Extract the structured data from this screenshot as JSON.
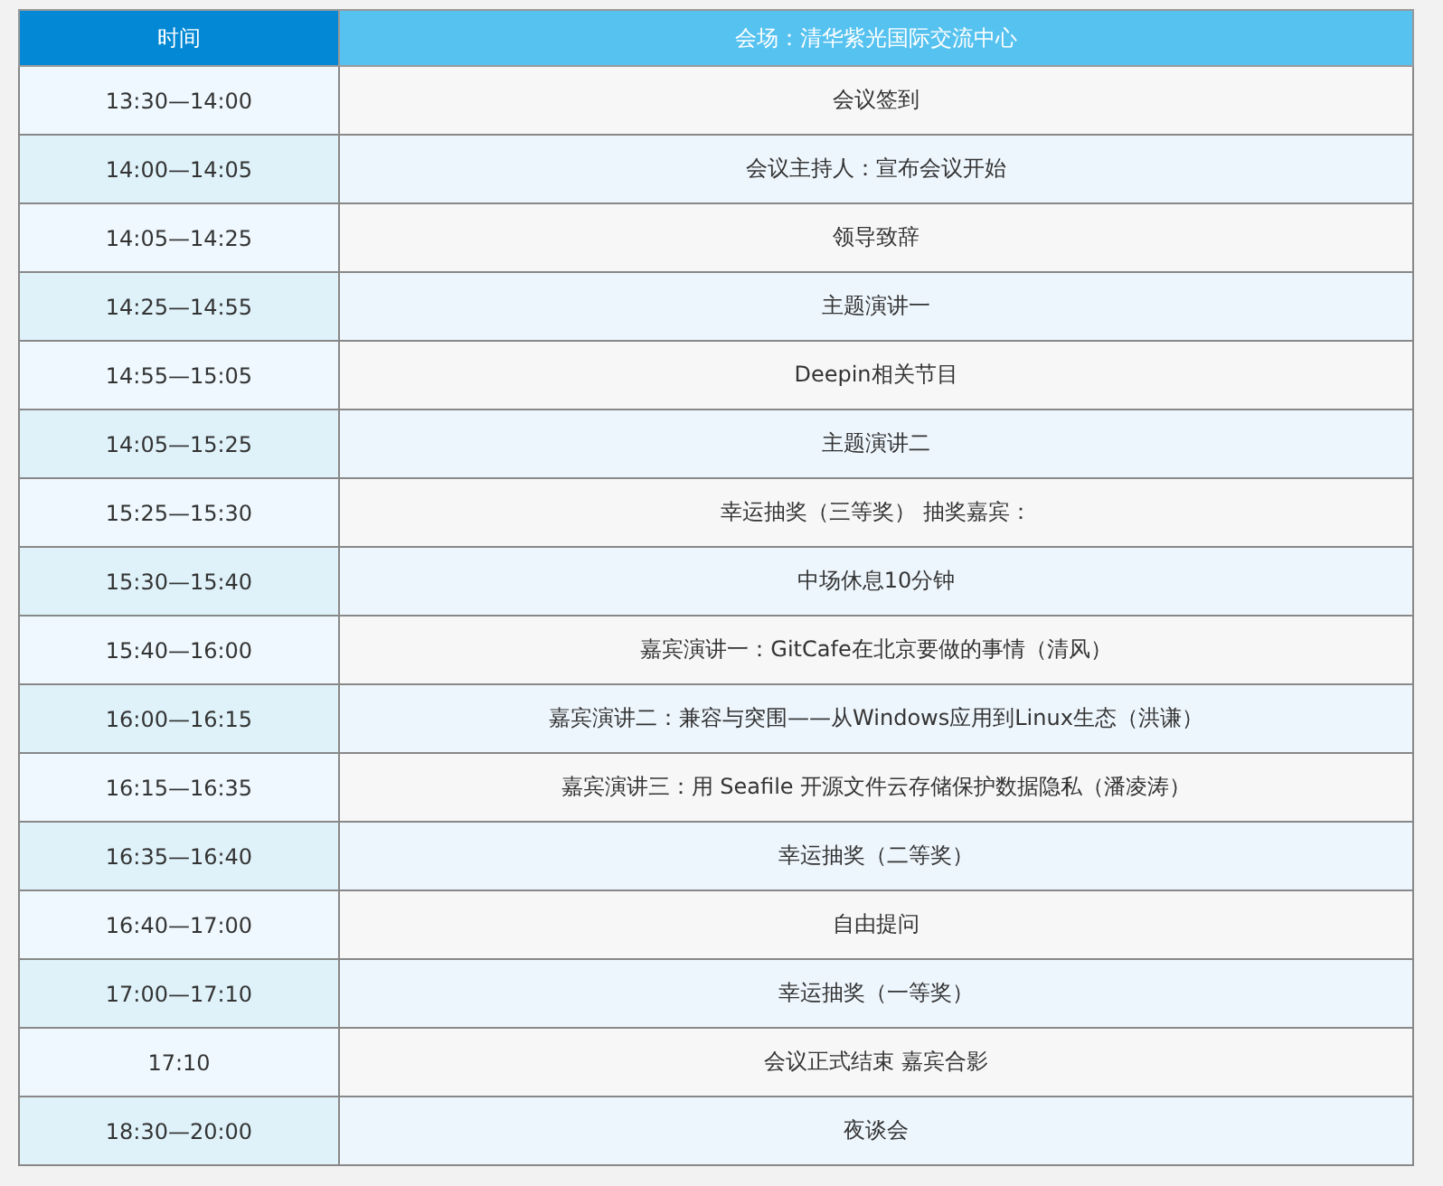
{
  "table": {
    "columns": [
      "时间",
      "会场：清华紫光国际交流中心"
    ],
    "rows": [
      {
        "time": "13:30—14:00",
        "item": "会议签到"
      },
      {
        "time": "14:00—14:05",
        "item": "会议主持人：宣布会议开始"
      },
      {
        "time": "14:05—14:25",
        "item": "领导致辞"
      },
      {
        "time": "14:25—14:55",
        "item": "主题演讲一"
      },
      {
        "time": "14:55—15:05",
        "item": "Deepin相关节目"
      },
      {
        "time": "14:05—15:25",
        "item": "主题演讲二"
      },
      {
        "time": "15:25—15:30",
        "item": "幸运抽奖（三等奖） 抽奖嘉宾："
      },
      {
        "time": "15:30—15:40",
        "item": "中场休息10分钟"
      },
      {
        "time": "15:40—16:00",
        "item": "嘉宾演讲一：GitCafe在北京要做的事情（清风）"
      },
      {
        "time": "16:00—16:15",
        "item": "嘉宾演讲二：兼容与突围——从Windows应用到Linux生态（洪谦）"
      },
      {
        "time": "16:15—16:35",
        "item": "嘉宾演讲三：用 Seafile 开源文件云存储保护数据隐私（潘凌涛）"
      },
      {
        "time": "16:35—16:40",
        "item": "幸运抽奖（二等奖）"
      },
      {
        "time": "16:40—17:00",
        "item": "自由提问"
      },
      {
        "time": "17:00—17:10",
        "item": "幸运抽奖（一等奖）"
      },
      {
        "time": "17:10",
        "item": "会议正式结束 嘉宾合影"
      },
      {
        "time": "18:30—20:00",
        "item": "夜谈会"
      }
    ]
  }
}
